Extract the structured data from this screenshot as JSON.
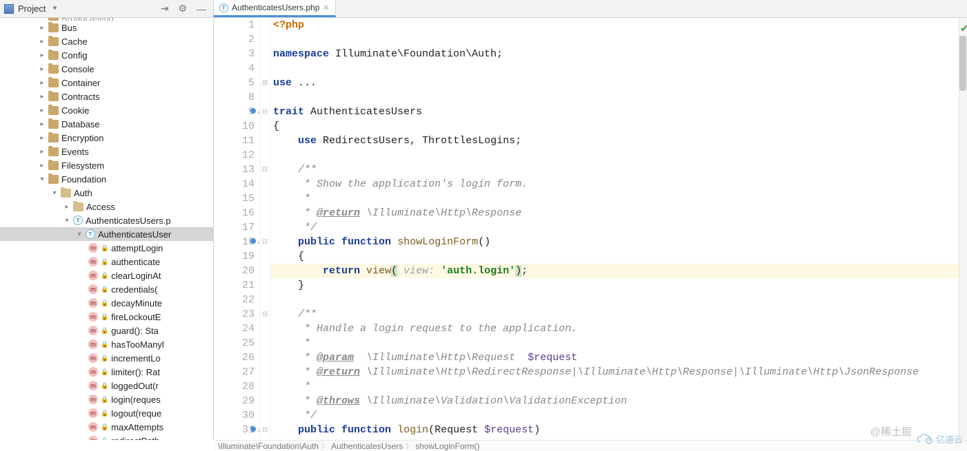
{
  "toolbar": {
    "project_label": "Project",
    "tab_file": "AuthenticatesUsers.php"
  },
  "tree": {
    "top_cut": "Broadcasting",
    "items": [
      {
        "label": "Bus",
        "depth": 3
      },
      {
        "label": "Cache",
        "depth": 3
      },
      {
        "label": "Config",
        "depth": 3
      },
      {
        "label": "Console",
        "depth": 3
      },
      {
        "label": "Container",
        "depth": 3
      },
      {
        "label": "Contracts",
        "depth": 3
      },
      {
        "label": "Cookie",
        "depth": 3
      },
      {
        "label": "Database",
        "depth": 3
      },
      {
        "label": "Encryption",
        "depth": 3
      },
      {
        "label": "Events",
        "depth": 3
      },
      {
        "label": "Filesystem",
        "depth": 3
      },
      {
        "label": "Foundation",
        "depth": 3,
        "expanded": true
      },
      {
        "label": "Auth",
        "depth": 4,
        "expanded": true,
        "sub": true
      },
      {
        "label": "Access",
        "depth": 5,
        "sub": true,
        "hasChildren": true
      },
      {
        "label": "AuthenticatesUsers.p",
        "depth": 5,
        "class": true,
        "expanded": true
      },
      {
        "label": "AuthenticatesUser",
        "depth": 6,
        "class": true,
        "expanded": true,
        "sel": true
      }
    ],
    "methods": [
      "attemptLogin",
      "authenticate",
      "clearLoginAt",
      "credentials(",
      "decayMinute",
      "fireLockoutE",
      "guard(): Sta",
      "hasTooManyl",
      "incrementLo",
      "limiter(): Rat",
      "loggedOut(r",
      "login(reques",
      "logout(reque",
      "maxAttempts",
      "redirectPath"
    ]
  },
  "editor": {
    "lines": [
      {
        "n": 1,
        "frag": [
          [
            "kw-orange",
            "<?php"
          ]
        ]
      },
      {
        "n": 2,
        "frag": []
      },
      {
        "n": 3,
        "frag": [
          [
            "kw",
            "namespace"
          ],
          [
            "",
            " Illuminate\\Foundation\\Auth;"
          ]
        ]
      },
      {
        "n": 4,
        "frag": []
      },
      {
        "n": 5,
        "frag": [
          [
            "kw",
            "use"
          ],
          [
            "",
            " ..."
          ]
        ],
        "fold": "plus"
      },
      {
        "n": 8,
        "frag": []
      },
      {
        "n": 9,
        "mark": "down",
        "frag": [
          [
            "kw",
            "trait"
          ],
          [
            "",
            " AuthenticatesUsers"
          ]
        ],
        "fold": "minus"
      },
      {
        "n": 10,
        "frag": [
          [
            "",
            "{"
          ]
        ]
      },
      {
        "n": 11,
        "frag": [
          [
            "",
            "    "
          ],
          [
            "kw",
            "use"
          ],
          [
            "",
            " RedirectsUsers, ThrottlesLogins;"
          ]
        ]
      },
      {
        "n": 12,
        "frag": []
      },
      {
        "n": 13,
        "fold": "minus",
        "frag": [
          [
            "comm",
            "    /**"
          ]
        ]
      },
      {
        "n": 14,
        "frag": [
          [
            "comm",
            "     * Show the application's login form."
          ]
        ]
      },
      {
        "n": 15,
        "frag": [
          [
            "comm",
            "     *"
          ]
        ]
      },
      {
        "n": 16,
        "frag": [
          [
            "comm",
            "     * "
          ],
          [
            "doc-tag",
            "@return"
          ],
          [
            "comm",
            " \\Illuminate\\Http\\Response"
          ]
        ]
      },
      {
        "n": 17,
        "frag": [
          [
            "comm",
            "     */"
          ]
        ]
      },
      {
        "n": 18,
        "mark": "down",
        "fold": "minus",
        "frag": [
          [
            "",
            "    "
          ],
          [
            "kw",
            "public function"
          ],
          [
            "",
            " "
          ],
          [
            "fn",
            "showLoginForm"
          ],
          [
            "",
            "()"
          ]
        ]
      },
      {
        "n": 19,
        "frag": [
          [
            "",
            "    {"
          ]
        ]
      },
      {
        "n": 20,
        "hl": true,
        "frag": [
          [
            "",
            "        "
          ],
          [
            "kw",
            "return"
          ],
          [
            "",
            " "
          ],
          [
            "fn",
            "view"
          ],
          [
            "paren-hl",
            "("
          ],
          [
            "",
            " "
          ],
          [
            "param-hint",
            "view:"
          ],
          [
            "",
            " "
          ],
          [
            "str",
            "'auth.login'"
          ],
          [
            "paren-hl",
            ")"
          ],
          [
            "",
            ";"
          ]
        ]
      },
      {
        "n": 21,
        "frag": [
          [
            "",
            "    }"
          ]
        ]
      },
      {
        "n": 22,
        "frag": []
      },
      {
        "n": 23,
        "fold": "minus",
        "frag": [
          [
            "comm",
            "    /**"
          ]
        ]
      },
      {
        "n": 24,
        "frag": [
          [
            "comm",
            "     * Handle a login request to the application."
          ]
        ]
      },
      {
        "n": 25,
        "frag": [
          [
            "comm",
            "     *"
          ]
        ]
      },
      {
        "n": 26,
        "frag": [
          [
            "comm",
            "     * "
          ],
          [
            "doc-tag",
            "@param"
          ],
          [
            "comm",
            "  \\Illuminate\\Http\\Request  "
          ],
          [
            "iv",
            "$request"
          ]
        ]
      },
      {
        "n": 27,
        "frag": [
          [
            "comm",
            "     * "
          ],
          [
            "doc-tag",
            "@return"
          ],
          [
            "comm",
            " \\Illuminate\\Http\\RedirectResponse|\\Illuminate\\Http\\Response|\\Illuminate\\Http\\JsonResponse"
          ]
        ]
      },
      {
        "n": 28,
        "frag": [
          [
            "comm",
            "     *"
          ]
        ]
      },
      {
        "n": 29,
        "frag": [
          [
            "comm",
            "     * "
          ],
          [
            "doc-tag",
            "@throws"
          ],
          [
            "comm",
            " \\Illuminate\\Validation\\ValidationException"
          ]
        ]
      },
      {
        "n": 30,
        "frag": [
          [
            "comm",
            "     */"
          ]
        ]
      },
      {
        "n": 31,
        "mark": "down",
        "fold": "minus",
        "frag": [
          [
            "",
            "    "
          ],
          [
            "kw",
            "public function"
          ],
          [
            "",
            " "
          ],
          [
            "fn",
            "login"
          ],
          [
            "",
            "(Request "
          ],
          [
            "iv",
            "$request"
          ],
          [
            "",
            ")"
          ]
        ]
      }
    ]
  },
  "breadcrumb": [
    "\\Illuminate\\Foundation\\Auth",
    "AuthenticatesUsers",
    "showLoginForm()"
  ],
  "watermark": "@稀土掘",
  "brand": "亿速云"
}
